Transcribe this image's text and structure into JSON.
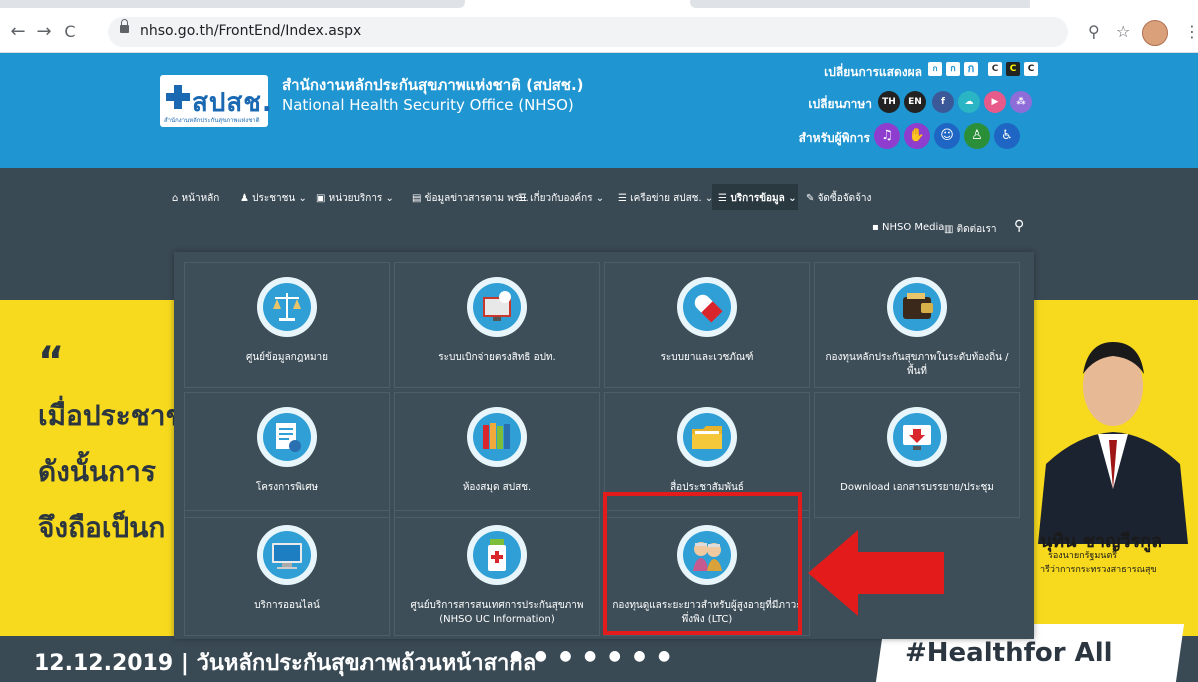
{
  "browser": {
    "url": "nhso.go.th/FrontEnd/Index.aspx",
    "nav_icons": [
      "back-arrow",
      "forward-arrow",
      "reload"
    ],
    "right_icons": [
      "zoom",
      "star",
      "profile",
      "menu"
    ]
  },
  "header": {
    "logo_text": "สปสช.",
    "logo_sub": "สำนักงานหลักประกันสุขภาพแห่งชาติ",
    "org_th": "สำนักงานหลักประกันสุขภาพแห่งชาติ (สปสช.)",
    "org_en": "National Health Security Office (NHSO)",
    "display_label": "เปลี่ยนการแสดงผล",
    "font_sizes": [
      "ก",
      "ก",
      "ก"
    ],
    "contrast": [
      "C",
      "C",
      "C"
    ],
    "language_label": "เปลี่ยนภาษา",
    "languages": [
      "TH",
      "EN"
    ],
    "accessibility_label": "สำหรับผู้พิการ"
  },
  "nav": {
    "items": [
      "หน้าหลัก",
      "ประชาชน",
      "หน่วยบริการ",
      "ข้อมูลข่าวสารตาม พรบ.",
      "เกี่ยวกับองค์กร",
      "เครือข่าย สปสช.",
      "บริการข้อมูล",
      "จัดซื้อจัดจ้าง"
    ],
    "media": "NHSO Media",
    "contact": "ติดต่อเรา"
  },
  "menu": {
    "items": [
      "ศูนย์ข้อมูลกฎหมาย",
      "ระบบเบิกจ่ายตรงสิทธิ อปท.",
      "ระบบยาและเวชภัณฑ์",
      "กองทุนหลักประกันสุขภาพในระดับท้องถิ่น / พื้นที่",
      "โครงการพิเศษ",
      "ห้องสมุด สปสช.",
      "สื่อประชาสัมพันธ์",
      "Download เอกสารบรรยาย/ประชุม",
      "บริการออนไลน์",
      "ศูนย์บริการสารสนเทศการประกันสุขภาพ (NHSO UC Information)",
      "กองทุนดูแลระยะยาวสำหรับผู้สูงอายุที่มีภาวะพึ่งพิง (LTC)"
    ]
  },
  "banner": {
    "quote": "“",
    "line1": "เมื่อประชาช",
    "line2": "ดังนั้นการ",
    "line3": "จึงถือเป็นก",
    "person_name": "นุทิน ชาญวีรกูล",
    "person_title1": "รองนายกรัฐมนตรี",
    "person_title2": "ารีว่าการกระทรวงสาธารณสุข",
    "date_line": "12.12.2019   |   วันหลักประกันสุขภาพถ้วนหน้าสากล",
    "hashtag": "#Healthfor All",
    "dots": "● ● ● ● ● ● ●"
  },
  "colors": {
    "header_blue": "#1f95d1",
    "navbar": "#3a4a55",
    "banner_yellow": "#f7d91e",
    "highlight_red": "#e31b1b"
  }
}
